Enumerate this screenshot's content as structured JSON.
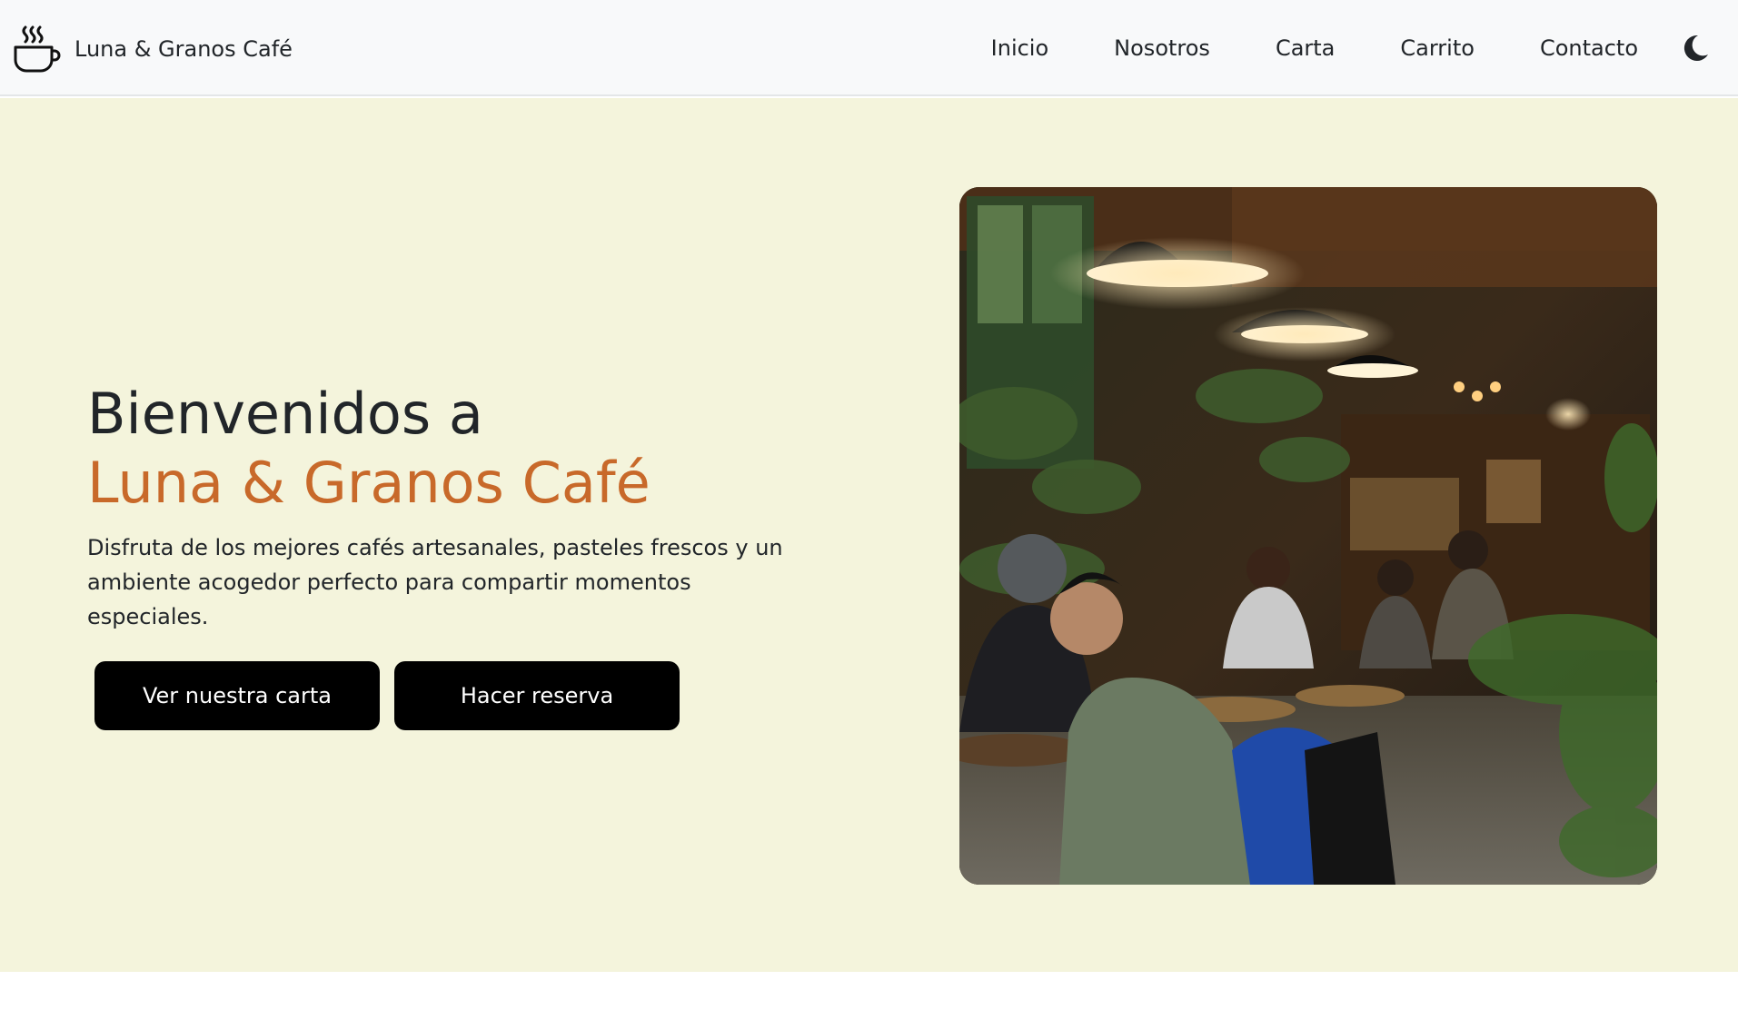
{
  "header": {
    "brand": "Luna & Granos Café",
    "nav": [
      "Inicio",
      "Nosotros",
      "Carta",
      "Carrito",
      "Contacto"
    ],
    "theme_icon": "moon-icon",
    "brand_icon": "coffee-cup-icon"
  },
  "hero": {
    "title_line1": "Bienvenidos a",
    "title_line2": "Luna & Granos Café",
    "lead": "Disfruta de los mejores cafés artesanales, pasteles frescos y un ambiente acogedor perfecto para compartir momentos especiales.",
    "primary_button": "Ver nuestra carta",
    "secondary_button": "Hacer reserva"
  },
  "colors": {
    "accent": "#c8692a",
    "hero_background": "#f4f4dc",
    "navbar_background": "#f8f9fa",
    "button_background": "#000000"
  }
}
